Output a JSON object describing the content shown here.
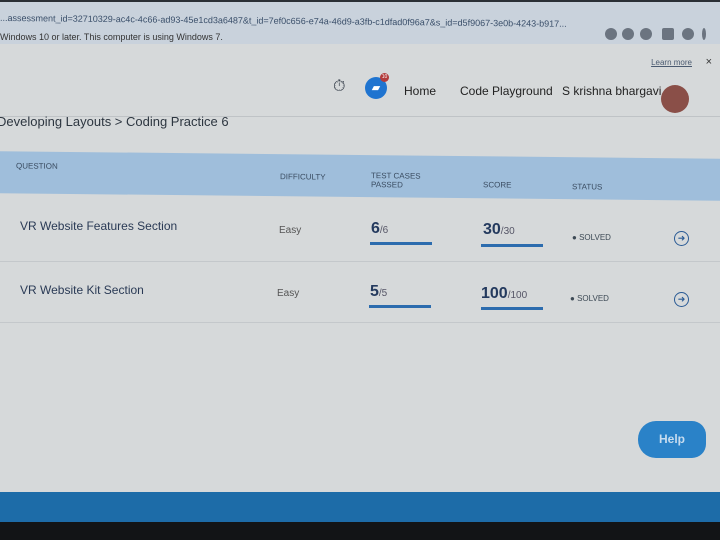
{
  "browser": {
    "url": "...assessment_id=32710329-ac4c-4c66-ad93-45e1cd3a6487&t_id=7ef0c656-e74a-46d9-a3fb-c1dfad0f96a7&s_id=d5f9067-3e0b-4243-b917...",
    "infobar_text": "Windows 10 or later. This computer is using Windows 7.",
    "learn_more": "Learn more",
    "close": "×"
  },
  "nav": {
    "notification_count": "10",
    "home": "Home",
    "code_playground": "Code Playground",
    "user_name": "S krishna bhargavi"
  },
  "breadcrumb": "Developing Layouts > Coding Practice 6",
  "table": {
    "headers": {
      "question": "QUESTION",
      "difficulty": "DIFFICULTY",
      "test_cases": "TEST CASES PASSED",
      "score": "SCORE",
      "status": "STATUS"
    },
    "rows": [
      {
        "question": "VR Website Features Section",
        "difficulty": "Easy",
        "passed": "6",
        "total": "/6",
        "score": "30",
        "max": "/30",
        "status": "SOLVED",
        "progress": 1.0
      },
      {
        "question": "VR Website Kit Section",
        "difficulty": "Easy",
        "passed": "5",
        "total": "/5",
        "score": "100",
        "max": "/100",
        "status": "SOLVED",
        "progress": 1.0
      }
    ]
  },
  "help": "Help",
  "colors": {
    "accent": "#1f74d0",
    "header": "#9fbedb",
    "taskbar": "#1d6ca8"
  }
}
